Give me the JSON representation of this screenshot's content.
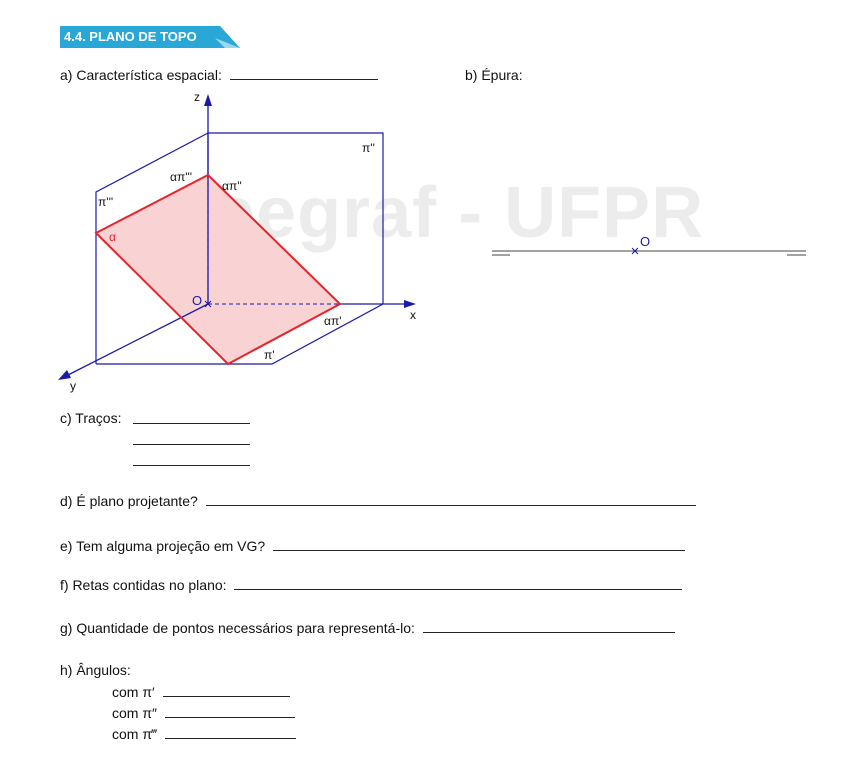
{
  "header": {
    "section_title": "4.4. PLANO DE TOPO",
    "banner_color": "#29a7d6"
  },
  "watermark": "geegraf - UFPR",
  "questions": {
    "a": "a) Característica espacial:",
    "b": "b) Épura:",
    "c": "c) Traços:",
    "d": "d) É plano projetante?",
    "e": "e) Tem alguma projeção em VG?",
    "f": "f) Retas contidas no plano:",
    "g": "g) Quantidade de pontos necessários para representá-lo:",
    "h": "h) Ângulos:",
    "h_items": [
      "com π′",
      "com π″",
      "com π‴"
    ]
  },
  "figure3d": {
    "labels": {
      "z": "z",
      "x": "x",
      "y": "y",
      "origin": "O",
      "pi2": "π''",
      "pi3": "π'''",
      "pi1": "π'",
      "alpha": "α",
      "alpha_pi1": "απ'",
      "alpha_pi2": "απ''",
      "alpha_pi3": "απ'''"
    },
    "colors": {
      "axis": "#1a1aa8",
      "plane": "#e8242b",
      "plane_fill": "#f9d3d3",
      "text": "#111111"
    }
  },
  "epura": {
    "origin_label": "O"
  }
}
